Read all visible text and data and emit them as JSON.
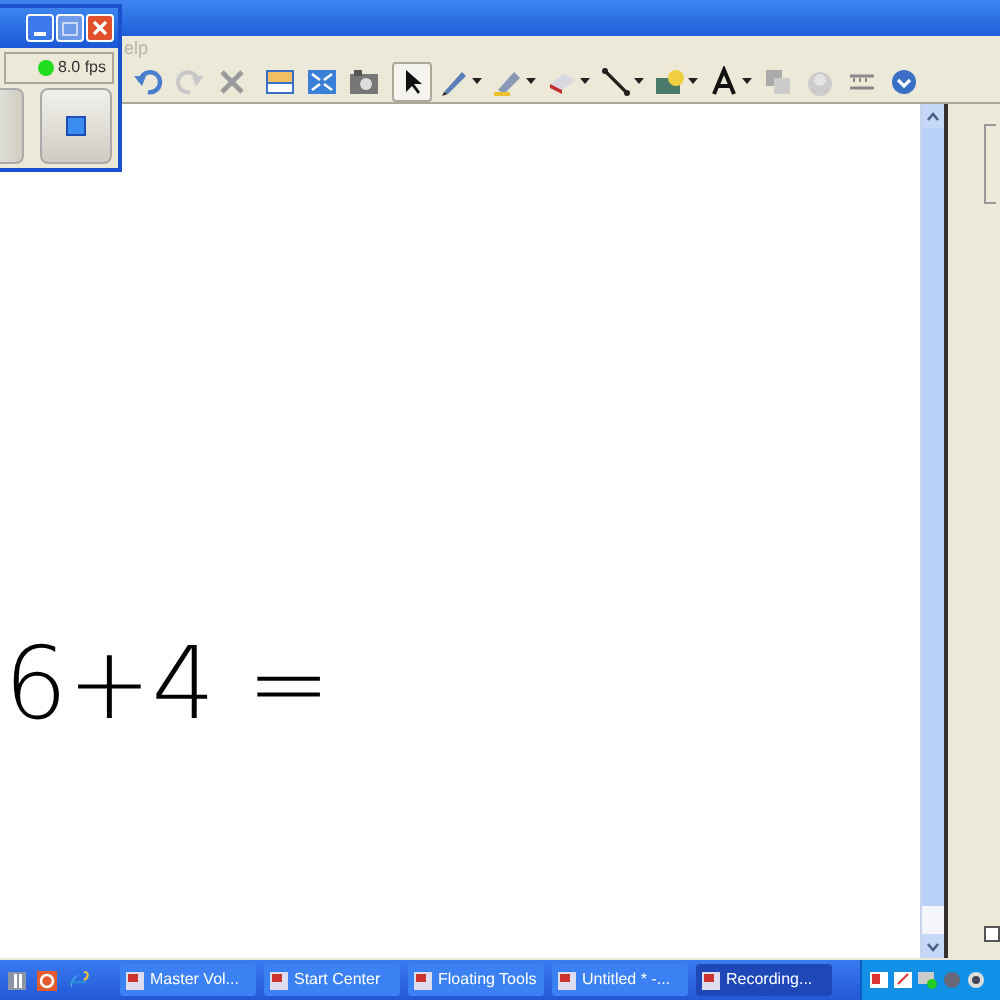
{
  "menu_bar": {
    "items": [
      "elp"
    ]
  },
  "toolbar": {
    "tools": [
      {
        "selected": false,
        "has_menu": false
      },
      {
        "selected": false,
        "has_menu": false
      },
      {
        "selected": false,
        "has_menu": false
      },
      {
        "selected": false,
        "has_menu": false
      },
      {
        "selected": false,
        "has_menu": false
      },
      {
        "selected": false,
        "has_menu": false
      },
      {
        "selected": true,
        "has_menu": false
      },
      {
        "selected": false,
        "has_menu": true
      },
      {
        "selected": false,
        "has_menu": true
      },
      {
        "selected": false,
        "has_menu": true
      },
      {
        "selected": false,
        "has_menu": true
      },
      {
        "selected": false,
        "has_menu": true
      },
      {
        "selected": false,
        "has_menu": true
      },
      {
        "selected": false,
        "has_menu": false
      },
      {
        "selected": false,
        "has_menu": false
      },
      {
        "selected": false,
        "has_menu": false
      },
      {
        "selected": false,
        "has_menu": false
      }
    ]
  },
  "canvas": {
    "ink_text": "6+4 ="
  },
  "side_panel": {
    "checkbox": {
      "checked": false
    }
  },
  "recorder": {
    "frame_rate": "8.0 fps"
  },
  "taskbar": {
    "buttons": [
      {
        "label": "Master Vol...",
        "selected": false
      },
      {
        "label": "Start Center",
        "selected": false
      },
      {
        "label": "Floating Tools",
        "selected": false
      },
      {
        "label": "Untitled * -...",
        "selected": false
      },
      {
        "label": "Recording...",
        "selected": true
      }
    ]
  }
}
